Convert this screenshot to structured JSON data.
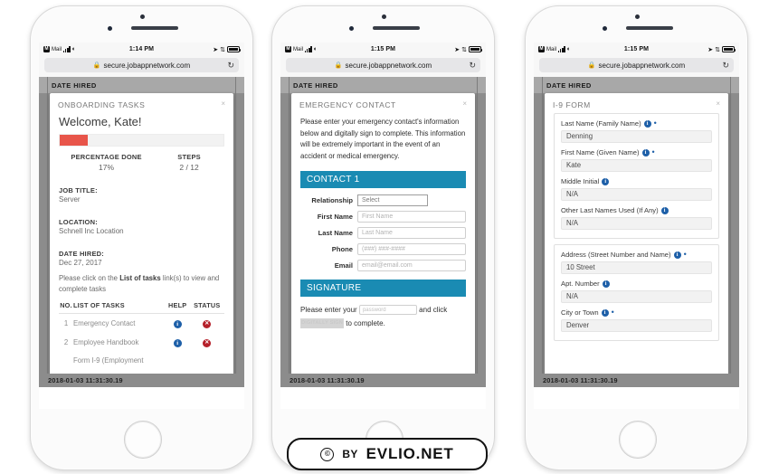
{
  "statusbar": {
    "mail_badge": "M",
    "mail_label": "Mail",
    "time_1": "1:14 PM",
    "time_2": "1:15 PM",
    "time_3": "1:15 PM",
    "wifi_icon": "wifi-icon",
    "signal_icon": "signal-bars-icon",
    "location_icon": "location-arrow-icon",
    "bluetooth_icon": "bluetooth-icon",
    "battery_icon": "battery-icon"
  },
  "browser": {
    "lock_icon": "lock-icon",
    "host": "secure.jobappnetwork.com",
    "reload_icon": "reload-icon"
  },
  "page": {
    "tab_label": "DATE HIRED",
    "footer_timestamp": "2018-01-03 11:31:30.19"
  },
  "colors": {
    "accent_teal": "#1a8bb3",
    "progress_red": "#e8554a",
    "info_blue": "#1d5fa8",
    "status_red": "#b5202a"
  },
  "phone1": {
    "modal_title": "ONBOARDING TASKS",
    "close_label": "×",
    "welcome": "Welcome, Kate!",
    "progress_percent": 17,
    "stats": [
      {
        "label": "PERCENTAGE DONE",
        "value": "17%"
      },
      {
        "label": "STEPS",
        "value": "2 / 12"
      }
    ],
    "details": [
      {
        "label": "JOB TITLE:",
        "value": "Server"
      },
      {
        "label": "LOCATION:",
        "value": "Schnell Inc Location"
      },
      {
        "label": "DATE HIRED:",
        "value": "Dec 27, 2017"
      }
    ],
    "hint_pre": "Please click on the ",
    "hint_link": "List of tasks",
    "hint_post": " link(s) to view and complete tasks",
    "table": {
      "headers": [
        "NO.",
        "LIST OF TASKS",
        "HELP",
        "STATUS"
      ],
      "rows": [
        {
          "no": "1",
          "task": "Emergency Contact",
          "help": "i",
          "status": "✕"
        },
        {
          "no": "2",
          "task": "Employee Handbook",
          "help": "i",
          "status": "✕"
        },
        {
          "no": "",
          "task": "Form I-9 (Employment",
          "help": "",
          "status": ""
        }
      ]
    }
  },
  "phone2": {
    "modal_title": "EMERGENCY CONTACT",
    "close_label": "×",
    "lead": "Please enter your emergency contact's information below and digitally sign to complete. This information will be extremely important in the event of an accident or medical emergency.",
    "section_contact": "CONTACT 1",
    "fields": [
      {
        "label": "Relationship",
        "placeholder": "Select",
        "type": "select"
      },
      {
        "label": "First Name",
        "placeholder": "First Name",
        "type": "text"
      },
      {
        "label": "Last Name",
        "placeholder": "Last Name",
        "type": "text"
      },
      {
        "label": "Phone",
        "placeholder": "(###) ###-####",
        "type": "text"
      },
      {
        "label": "Email",
        "placeholder": "email@email.com",
        "type": "text"
      }
    ],
    "section_signature": "SIGNATURE",
    "sig_pre": "Please enter your",
    "sig_input_placeholder": "password",
    "sig_mid": "and click",
    "sig_button": "DIGITALLY SIGN",
    "sig_post": "to complete."
  },
  "phone3": {
    "modal_title": "I-9 FORM",
    "close_label": "×",
    "group1": [
      {
        "label": "Last Name (Family Name)",
        "required": true,
        "value": "Denning"
      },
      {
        "label": "First Name (Given Name)",
        "required": true,
        "value": "Kate"
      },
      {
        "label": "Middle Initial",
        "required": false,
        "value": "N/A"
      },
      {
        "label": "Other Last Names Used (If Any)",
        "required": false,
        "value": "N/A"
      }
    ],
    "group2": [
      {
        "label": "Address (Street Number and Name)",
        "required": true,
        "value": "10 Street"
      },
      {
        "label": "Apt. Number",
        "required": false,
        "value": "N/A"
      },
      {
        "label": "City or Town",
        "required": true,
        "value": "Denver"
      }
    ],
    "info_icon": "i",
    "required_marker": "•"
  },
  "watermark": {
    "copyright": "©",
    "by": "BY",
    "site": "EVLIO.NET"
  }
}
